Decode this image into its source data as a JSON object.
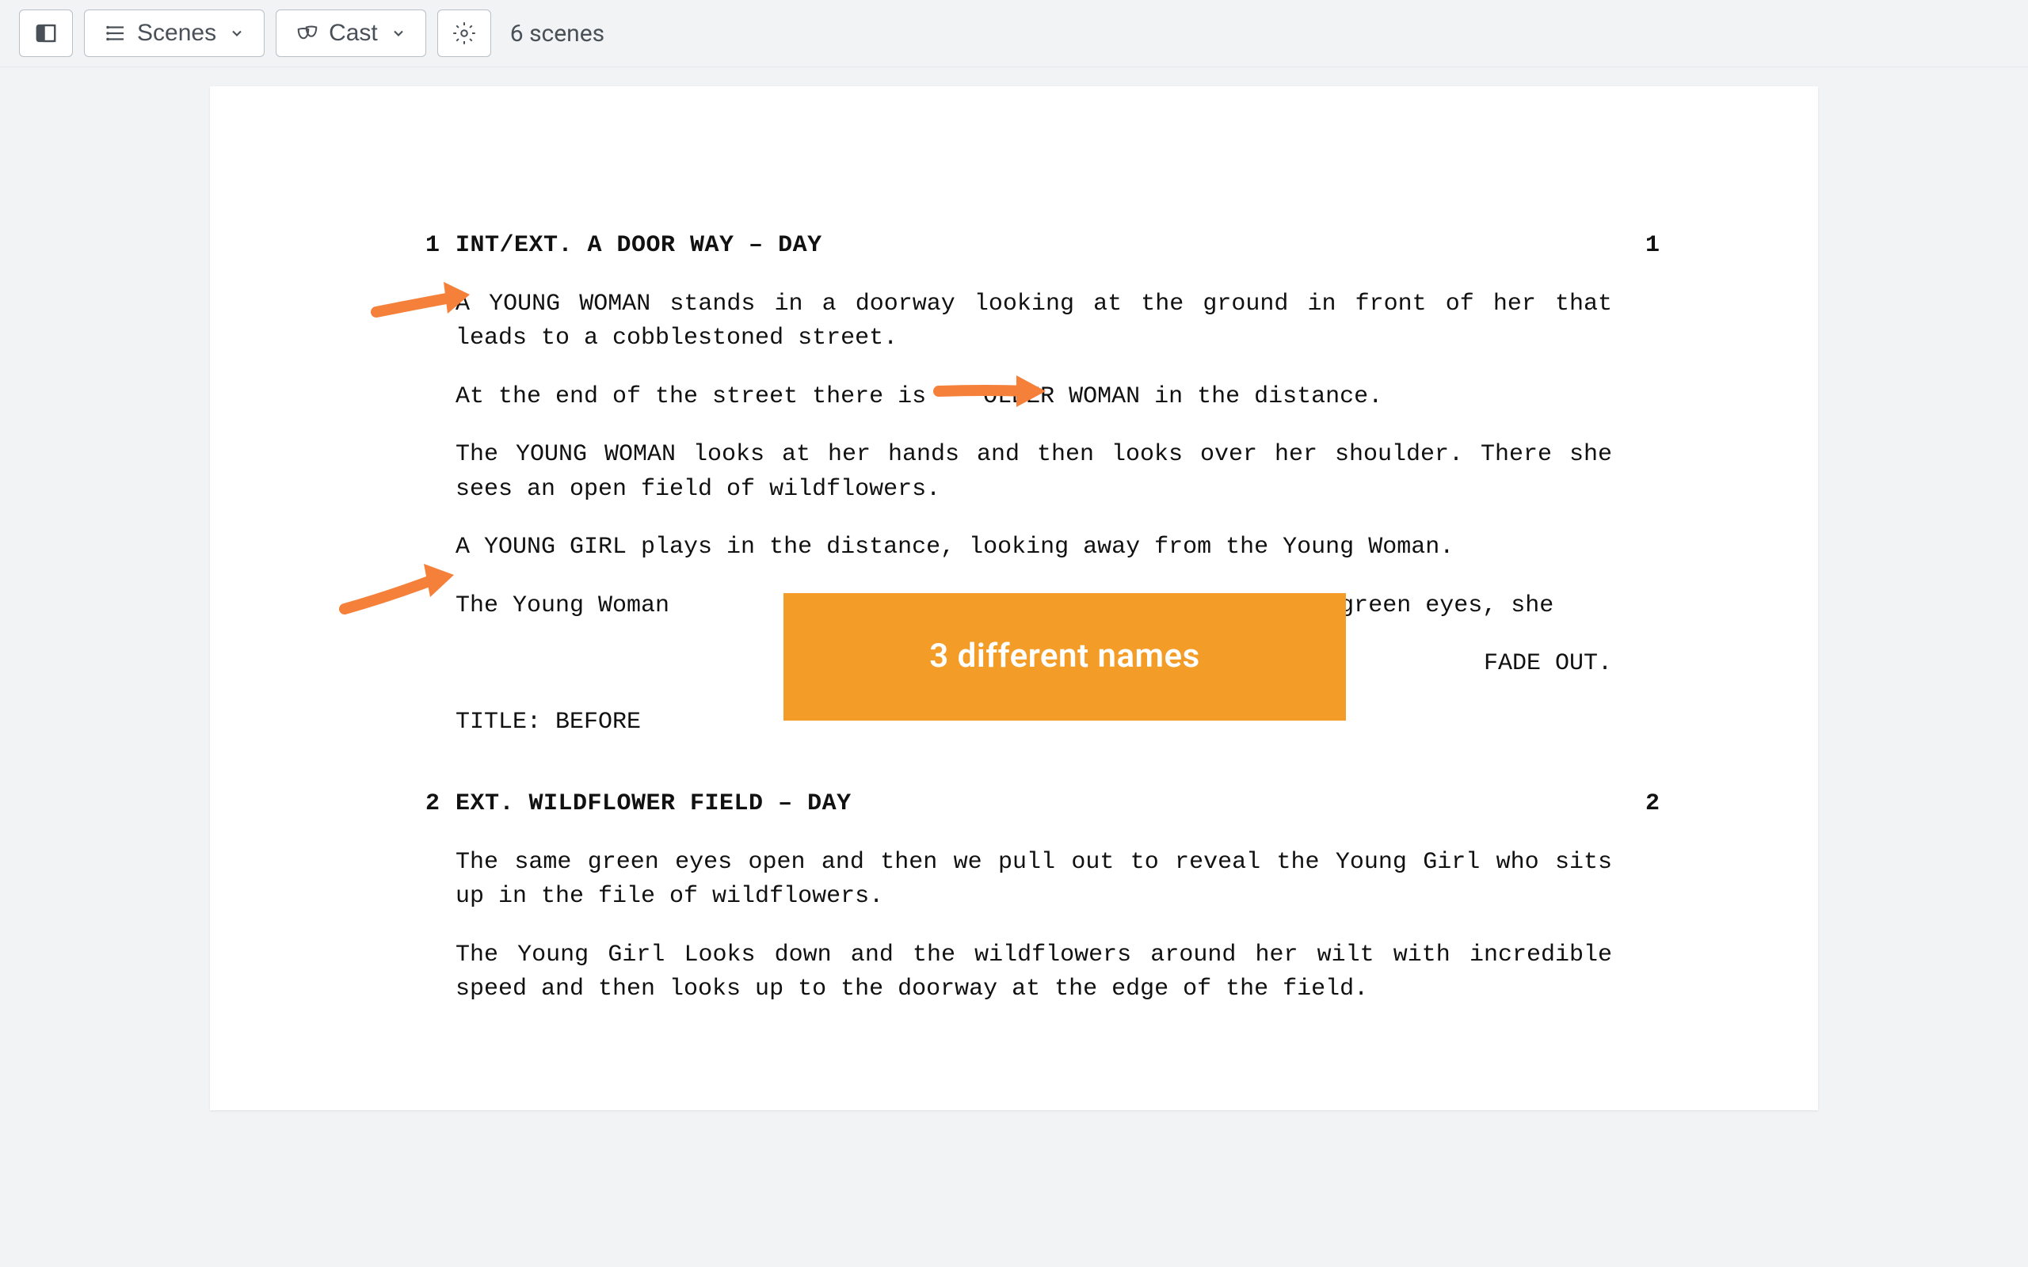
{
  "toolbar": {
    "scenes_label": "Scenes",
    "cast_label": "Cast",
    "scene_count_label": "6 scenes"
  },
  "document": {
    "scenes": [
      {
        "num": "1",
        "heading": "INT/EXT. A DOOR WAY – DAY",
        "actions": [
          "A YOUNG WOMAN stands in a doorway looking at the ground in front of her that leads to a cobblestoned street.",
          "At the end of the street there is    OLDER WOMAN in the distance.",
          "The YOUNG WOMAN looks at her hands and then looks over her shoulder. There she sees an open field of wildflowers.",
          "A YOUNG GIRL plays in the distance, looking away from the Young Woman.",
          "The Young Woman                                  on startling green eyes, she"
        ],
        "transition": "FADE OUT.",
        "title": "TITLE: BEFORE"
      },
      {
        "num": "2",
        "heading": "EXT. WILDFLOWER FIELD – DAY",
        "actions": [
          "The same green eyes open and then we pull out to reveal the Young Girl who sits up in the file of wildflowers.",
          "The Young Girl Looks down and the wildflowers around her wilt with incredible speed and then looks up to the doorway at the edge of the field."
        ]
      }
    ]
  },
  "annotation": {
    "callout": "3 different names"
  }
}
